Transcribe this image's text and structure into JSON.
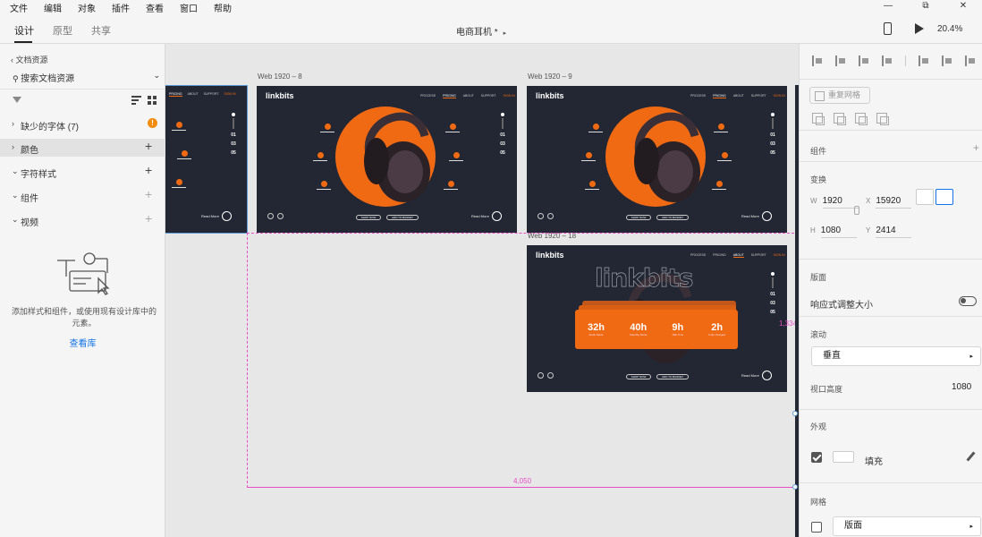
{
  "menu": [
    "文件",
    "编辑",
    "对象",
    "插件",
    "查看",
    "窗口",
    "帮助"
  ],
  "window_controls": [
    "—",
    "⧉",
    "✕"
  ],
  "appbar": {
    "tabs": [
      "设计",
      "原型",
      "共享"
    ],
    "doc_title": "电商耳机 *",
    "zoom": "20.4%"
  },
  "left_panel": {
    "back_label": "文档资源",
    "search_placeholder": "搜索文档资源",
    "missing_fonts": "缺少的字体 (7)",
    "sections": [
      "颜色",
      "字符样式",
      "组件",
      "视频"
    ],
    "hint": "添加样式和组件，或使用现有设计库中的元素。",
    "link": "查看库"
  },
  "canvas": {
    "artboards": [
      {
        "label": "Web 1920 – 8"
      },
      {
        "label": "Web 1920 – 9"
      },
      {
        "label": "Web 1920 – 18"
      }
    ],
    "brand": "linkbits",
    "brand_outline": "linkbits",
    "nav": [
      "PROCESS",
      "PRICING",
      "ABOUT",
      "SUPPORT",
      "SIGN IN"
    ],
    "nav_small": [
      "PRICING",
      "ABOUT",
      "SUPPORT",
      "SIGN IN"
    ],
    "side_nums": [
      "01",
      "03",
      "05"
    ],
    "read_more": "Read More",
    "btn_shop": "SHOP NOW",
    "btn_cart": "ADD TO BASKET",
    "stats": [
      {
        "value": "32h",
        "sub": "Audio Mode"
      },
      {
        "value": "40h",
        "sub": "Standby Mode"
      },
      {
        "value": "9h",
        "sub": "Talk Time"
      },
      {
        "value": "2h",
        "sub": "Fully Charged"
      }
    ],
    "measure_width": "4,050",
    "measure_height": "1,334",
    "accent": "#f06a14",
    "artboard_bg": "#232733",
    "guide_color": "#e84fc7"
  },
  "right_panel": {
    "repeat_grid": "重复网格",
    "component": "组件",
    "transform": "变换",
    "w_label": "W",
    "w": "1920",
    "x_label": "X",
    "x": "15920",
    "h_label": "H",
    "h": "1080",
    "y_label": "Y",
    "y": "2414",
    "layout": "版面",
    "responsive": "响应式调整大小",
    "scroll": "滚动",
    "scroll_value": "垂直",
    "viewport_height_label": "视口高度",
    "viewport_height": "1080",
    "appearance": "外观",
    "fill_label": "填充",
    "fill_color": "#ffffff",
    "grid": "网格",
    "grid_value": "版面"
  }
}
